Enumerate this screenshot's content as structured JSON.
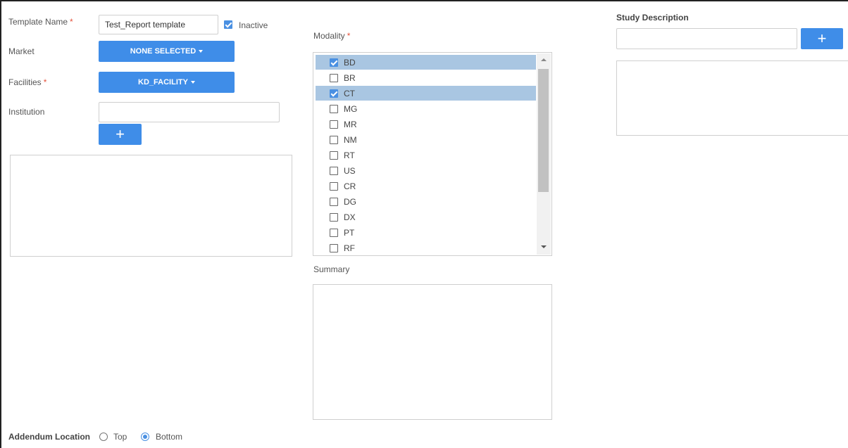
{
  "template_name": {
    "label": "Template Name",
    "required": "*",
    "value": "Test_Report template"
  },
  "inactive": {
    "label": "Inactive",
    "checked": true
  },
  "market": {
    "label": "Market",
    "button": "NONE SELECTED"
  },
  "facilities": {
    "label": "Facilities",
    "required": "*",
    "button": "KD_FACILITY"
  },
  "institution": {
    "label": "Institution",
    "value": "",
    "add_label": "+"
  },
  "modality": {
    "label": "Modality",
    "required": "*",
    "items": [
      {
        "code": "BD",
        "checked": true
      },
      {
        "code": "BR",
        "checked": false
      },
      {
        "code": "CT",
        "checked": true
      },
      {
        "code": "MG",
        "checked": false
      },
      {
        "code": "MR",
        "checked": false
      },
      {
        "code": "NM",
        "checked": false
      },
      {
        "code": "RT",
        "checked": false
      },
      {
        "code": "US",
        "checked": false
      },
      {
        "code": "CR",
        "checked": false
      },
      {
        "code": "DG",
        "checked": false
      },
      {
        "code": "DX",
        "checked": false
      },
      {
        "code": "PT",
        "checked": false
      },
      {
        "code": "RF",
        "checked": false
      }
    ]
  },
  "summary": {
    "label": "Summary"
  },
  "study_description": {
    "label": "Study Description",
    "value": "",
    "add_label": "+"
  },
  "addendum": {
    "label": "Addendum Location",
    "options": [
      "Top",
      "Bottom"
    ],
    "selected": "Bottom"
  },
  "colors": {
    "accent": "#3f8de8",
    "selection": "#a9c6e2",
    "required": "#e5533d"
  }
}
